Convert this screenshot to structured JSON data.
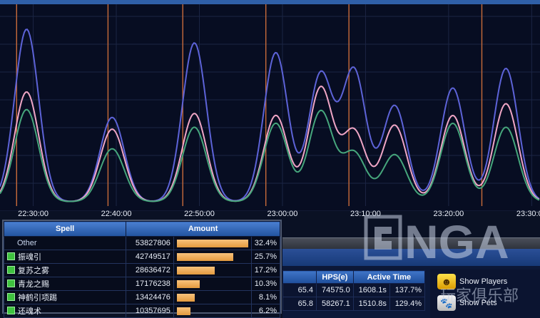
{
  "chart_data": {
    "type": "line",
    "title": "",
    "xlabel": "",
    "ylabel": "",
    "x_ticks": [
      "22:30:00",
      "22:40:00",
      "22:50:00",
      "23:00:00",
      "23:10:00",
      "23:20:00",
      "23:30:00"
    ],
    "x": [
      "22:26",
      "22:30",
      "22:40",
      "22:50",
      "23:00",
      "23:10",
      "23:20",
      "23:30"
    ],
    "grid": true,
    "series": [
      {
        "color": "#5d63d8",
        "peaks": [
          0.88,
          0.43,
          0.81,
          0.76,
          0.65,
          0.67,
          0.49,
          0.58,
          0.68
        ]
      },
      {
        "color": "#f0a6c6",
        "peaks": [
          0.56,
          0.37,
          0.45,
          0.44,
          0.58,
          0.36,
          0.39,
          0.44,
          0.5
        ]
      },
      {
        "color": "#46a67c",
        "peaks": [
          0.47,
          0.27,
          0.38,
          0.4,
          0.46,
          0.25,
          0.24,
          0.4,
          0.38
        ]
      }
    ],
    "event_markers": [
      "22:28",
      "22:39",
      "22:48",
      "22:58",
      "23:08",
      "23:24"
    ]
  },
  "spell_table": {
    "headers": {
      "spell": "Spell",
      "amount": "Amount"
    },
    "rows": [
      {
        "name": "Other",
        "amount": "53827806",
        "pct": "32.4%",
        "fraction": 0.324,
        "marker": false
      },
      {
        "name": "振魂引",
        "amount": "42749517",
        "pct": "25.7%",
        "fraction": 0.257,
        "marker": true
      },
      {
        "name": "复苏之雾",
        "amount": "28636472",
        "pct": "17.2%",
        "fraction": 0.172,
        "marker": true
      },
      {
        "name": "青龙之赐",
        "amount": "17176238",
        "pct": "10.3%",
        "fraction": 0.103,
        "marker": true
      },
      {
        "name": "神鹤引项踢",
        "amount": "13424476",
        "pct": "8.1%",
        "fraction": 0.081,
        "marker": true
      },
      {
        "name": "还魂术",
        "amount": "10357695",
        "pct": "6.2%",
        "fraction": 0.062,
        "marker": true
      }
    ]
  },
  "hps_table": {
    "headers": {
      "col0": "",
      "hps": "HPS(e)",
      "active": "Active Time"
    },
    "rows": [
      {
        "col0": "65.4",
        "hps": "74575.0",
        "time": "1608.1s",
        "pct": "137.7%"
      },
      {
        "col0": "65.8",
        "hps": "58267.1",
        "time": "1510.8s",
        "pct": "129.4%"
      }
    ]
  },
  "side_buttons": {
    "show_players": "Show Players",
    "show_pets": "Show Pets"
  },
  "watermark": {
    "text": "NGA",
    "subtitle": "玩家俱乐部"
  },
  "colors": {
    "accent": "#2f5fa8",
    "bar": "#f0ad55",
    "marker": "#3fc23f"
  }
}
